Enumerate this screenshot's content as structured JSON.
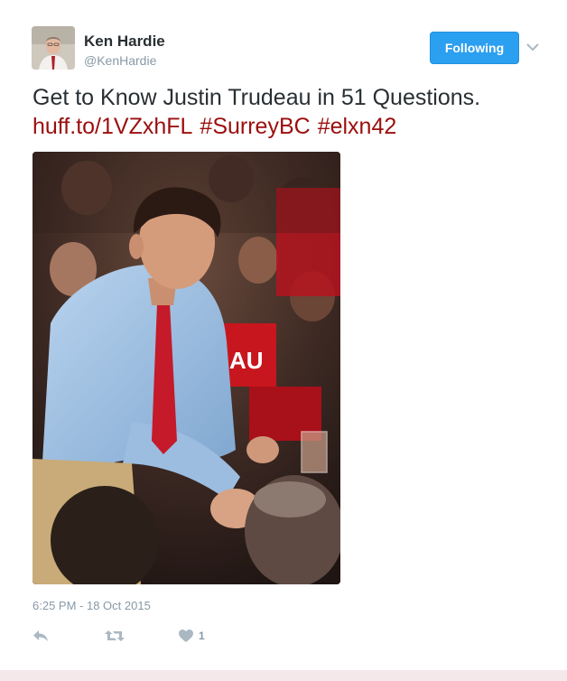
{
  "user": {
    "name": "Ken Hardie",
    "handle": "@KenHardie"
  },
  "follow_button": {
    "label": "Following"
  },
  "tweet": {
    "text": "Get to Know Justin Trudeau in 51 Questions.",
    "links": [
      "huff.to/1VZxhFL",
      "#SurreyBC",
      "#elxn42"
    ],
    "timestamp": "6:25 PM - 18 Oct 2015"
  },
  "actions": {
    "reply_icon": "reply-icon",
    "retweet_icon": "retweet-icon",
    "like_icon": "heart-icon",
    "like_count": "1"
  },
  "colors": {
    "accent": "#2b9ff0",
    "link": "#9b0e0e",
    "muted": "#8899a6",
    "text": "#292f33"
  }
}
